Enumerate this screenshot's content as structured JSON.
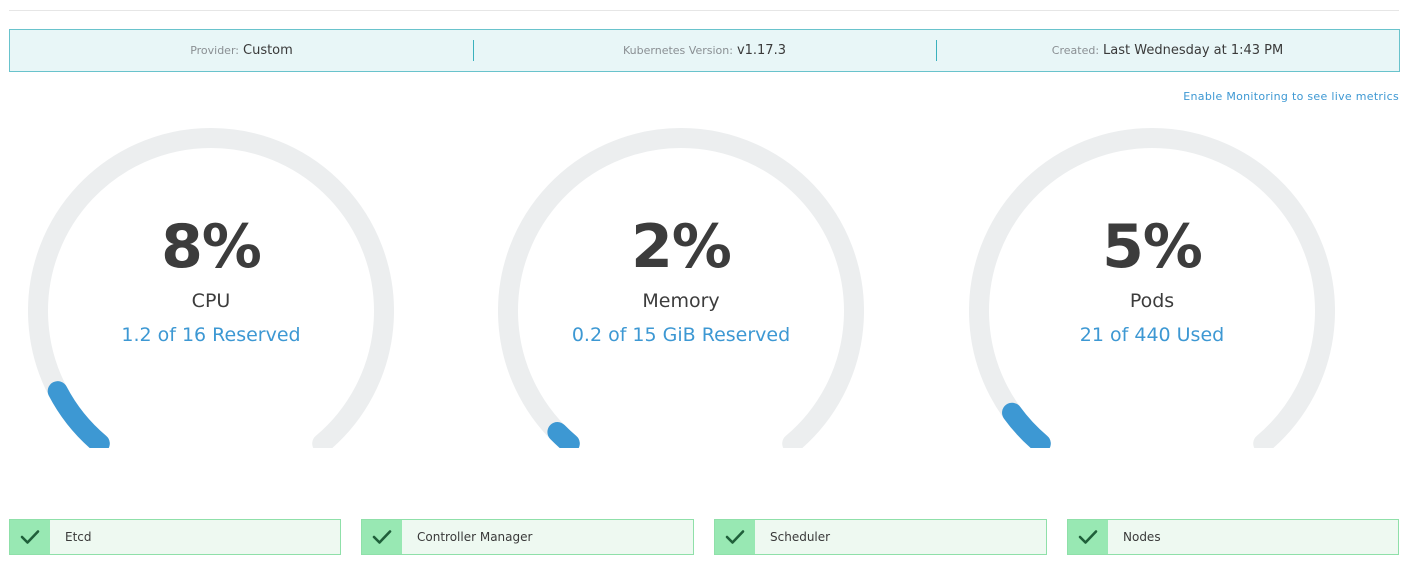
{
  "info_bar": {
    "provider_label": "Provider:",
    "provider_value": "Custom",
    "version_label": "Kubernetes Version:",
    "version_value": "v1.17.3",
    "created_label": "Created:",
    "created_value": "Last Wednesday at 1:43 PM"
  },
  "monitoring_link": "Enable Monitoring to see live metrics",
  "gauges": [
    {
      "percent_text": "8%",
      "fraction": 0.08,
      "name": "CPU",
      "detail": "1.2 of 16 Reserved"
    },
    {
      "percent_text": "2%",
      "fraction": 0.02,
      "name": "Memory",
      "detail": "0.2 of 15 GiB Reserved"
    },
    {
      "percent_text": "5%",
      "fraction": 0.05,
      "name": "Pods",
      "detail": "21 of 440 Used"
    }
  ],
  "status_checks": [
    {
      "label": "Etcd",
      "icon": "checkmark-icon",
      "healthy": true
    },
    {
      "label": "Controller Manager",
      "icon": "checkmark-icon",
      "healthy": true
    },
    {
      "label": "Scheduler",
      "icon": "checkmark-icon",
      "healthy": true
    },
    {
      "label": "Nodes",
      "icon": "checkmark-icon",
      "healthy": true
    }
  ],
  "colors": {
    "accent": "#3d98d3",
    "track": "#eceeef",
    "info_border": "#69c3cc",
    "ok_fill": "#98e8b3",
    "check": "#1f5f3a"
  }
}
